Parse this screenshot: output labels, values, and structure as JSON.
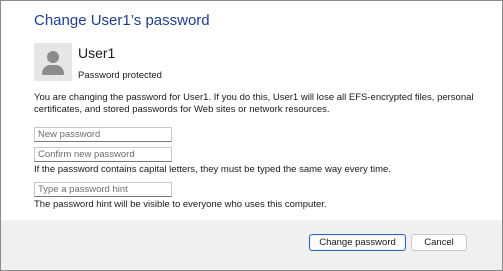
{
  "dialog": {
    "title": "Change User1’s password"
  },
  "user": {
    "avatar_icon": "user-avatar-icon",
    "name": "User1",
    "status": "Password protected"
  },
  "warning_text": "You are changing the password for User1.  If you do this, User1 will lose all EFS-encrypted files, personal certificates, and stored passwords for Web sites or network resources.",
  "fields": {
    "new_password": {
      "placeholder": "New password",
      "value": ""
    },
    "confirm_password": {
      "placeholder": "Confirm new password",
      "value": ""
    },
    "password_hint": {
      "placeholder": "Type a password hint",
      "value": ""
    }
  },
  "notes": {
    "caps": "If the password contains capital letters, they must be typed the same way every time.",
    "hint": "The password hint will be visible to everyone who uses this computer."
  },
  "buttons": {
    "change_password": "Change password",
    "cancel": "Cancel"
  },
  "colors": {
    "title": "#1e3e8c",
    "primary_border": "#2b66c4",
    "footer_bg": "#f0f0f0"
  }
}
